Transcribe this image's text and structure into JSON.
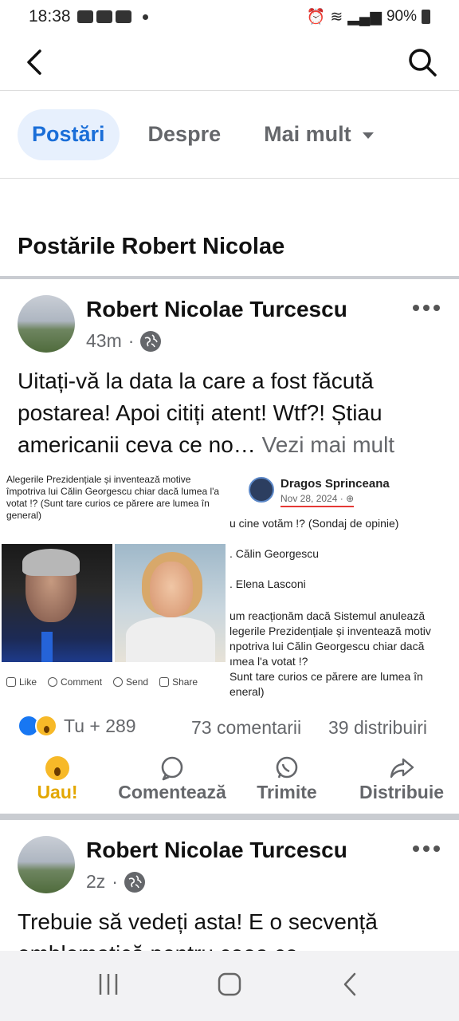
{
  "status_bar": {
    "time": "18:38",
    "battery": "90%"
  },
  "top_nav": {
    "back_icon": "back-arrow-icon",
    "search_icon": "search-icon"
  },
  "tabs": [
    {
      "label": "Postări",
      "active": true
    },
    {
      "label": "Despre",
      "active": false
    },
    {
      "label": "Mai mult",
      "active": false
    }
  ],
  "section_title": "Postările Robert Nicolae",
  "posts": [
    {
      "author": "Robert Nicolae Turcescu",
      "time": "43m",
      "text": "Uitați-vă la data la care a fost făcută postarea! Apoi citiți atent! Wtf?! Știau americanii ceva ce no…",
      "see_more": "Vezi mai mult",
      "image": {
        "left_caption": "Alegerile Prezidențiale și inventează motive împotriva lui Călin Georgescu chiar dacă lumea l'a votat !? (Sunt tare curios ce părere are lumea în general)",
        "left_actions": [
          "Like",
          "Comment",
          "Send",
          "Share"
        ],
        "right_name": "Dragos Sprinceana",
        "right_date": "Nov 28, 2024 · ",
        "right_lines": [
          "u cine votăm !? (Sondaj de opinie)",
          ". Călin Georgescu",
          ". Elena Lasconi",
          "um reacționăm dacă Sistemul anulează",
          "legerile Prezidențiale și inventează motiv",
          "npotriva lui Călin Georgescu chiar dacă",
          "ımea l'a votat !?",
          "Sunt tare curios ce părere are lumea în",
          "eneral)"
        ]
      },
      "stats": {
        "reactions": "Tu + 289",
        "comments": "73 comentarii",
        "shares": "39 distribuiri"
      },
      "actions": [
        {
          "label": "Uau!",
          "icon": "wow-reaction-icon"
        },
        {
          "label": "Comentează",
          "icon": "comment-icon"
        },
        {
          "label": "Trimite",
          "icon": "whatsapp-icon"
        },
        {
          "label": "Distribuie",
          "icon": "share-icon"
        }
      ]
    },
    {
      "author": "Robert Nicolae Turcescu",
      "time": "2z",
      "text": "Trebuie să vedeți asta! E o secvență emblematică pentru ceea ce"
    }
  ],
  "colors": {
    "accent": "#1a6ed8",
    "tab_active_bg": "#e7f0fd",
    "wow": "#e3a700"
  }
}
